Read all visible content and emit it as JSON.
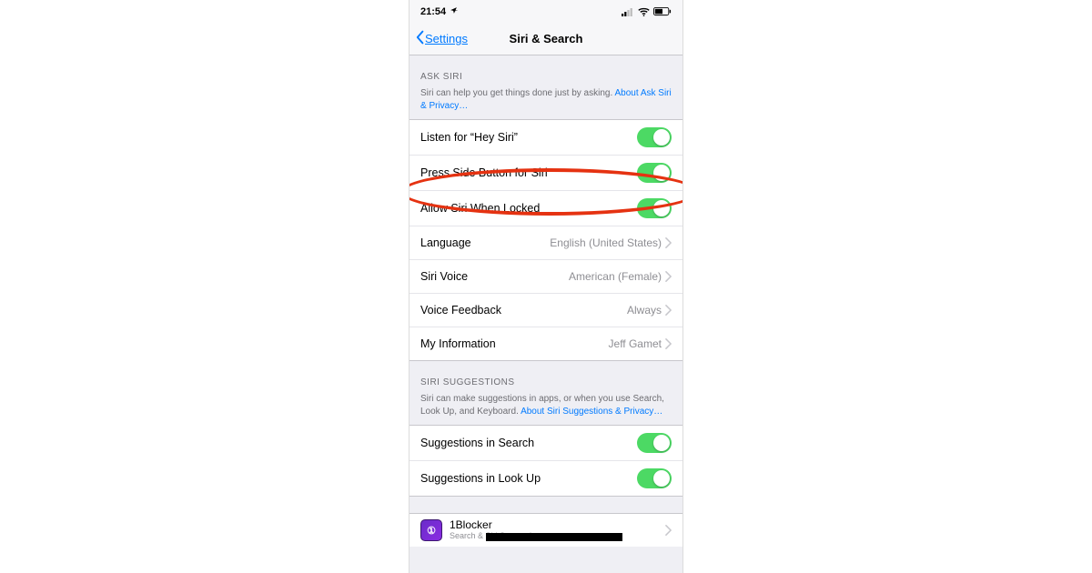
{
  "statusbar": {
    "time": "21:54"
  },
  "nav": {
    "back": "Settings",
    "title": "Siri & Search"
  },
  "section1": {
    "header": "ASK SIRI",
    "footer_text": "Siri can help you get things done just by asking. ",
    "footer_link": "About Ask Siri & Privacy…"
  },
  "rows1": {
    "listen": "Listen for “Hey Siri”",
    "press": "Press Side Button for Siri",
    "locked": "Allow Siri When Locked",
    "language_label": "Language",
    "language_value": "English (United States)",
    "voice_label": "Siri Voice",
    "voice_value": "American (Female)",
    "feedback_label": "Voice Feedback",
    "feedback_value": "Always",
    "myinfo_label": "My Information",
    "myinfo_value": "Jeff Gamet"
  },
  "section2": {
    "header": "SIRI SUGGESTIONS",
    "footer_text": "Siri can make suggestions in apps, or when you use Search, Look Up, and Keyboard. ",
    "footer_link": "About Siri Suggestions & Privacy…"
  },
  "rows2": {
    "sugg_search": "Suggestions in Search",
    "sugg_lookup": "Suggestions in Look Up"
  },
  "app": {
    "name": "1Blocker",
    "sub": "Search & Siri Suggestions"
  }
}
